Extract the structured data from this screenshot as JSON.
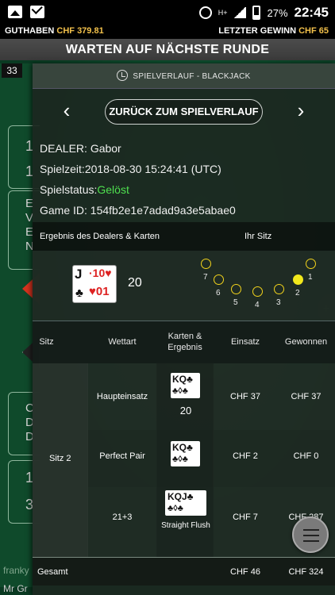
{
  "status_bar": {
    "battery": "27%",
    "time": "22:45",
    "network": "H+"
  },
  "balance_bar": {
    "balance_label": "GUTHABEN",
    "balance_value": "CHF 379.81",
    "last_win_label": "LETZTER GEWINN",
    "last_win_value": "CHF 65"
  },
  "round_status": "WARTEN AUF NÄCHSTE RUNDE",
  "background": {
    "number_badge": "33",
    "player_fragment": "franky",
    "player_fragment2": "Mr Gr",
    "chars": [
      "1",
      "1",
      "E",
      "V",
      "E",
      "N",
      "C",
      "D",
      "D",
      "1",
      "3"
    ]
  },
  "history_panel": {
    "title": "SPIELVERLAUF - BLACKJACK",
    "back_button": "ZURÜCK ZUM SPIELVERLAUF",
    "prev_arrow": "‹",
    "next_arrow": "›",
    "dealer_label": "DEALER: ",
    "dealer_name": "Gabor",
    "time_label": "Spielzeit:",
    "time_value": "2018-08-30 15:24:41 (UTC)",
    "status_label": "Spielstatus:",
    "status_value": "Gelöst",
    "game_id_label": "Game ID: ",
    "game_id_value": "154fb2e1e7adad9a3e5abae0",
    "results_header_left": "Ergebnis des Dealers & Karten",
    "results_header_right": "Ihr Sitz",
    "dealer_cards": [
      "J♣",
      "10♥"
    ],
    "dealer_score": "20",
    "seats": [
      "1",
      "2",
      "3",
      "4",
      "5",
      "6",
      "7"
    ],
    "your_seat": "2",
    "table_headers": {
      "seat": "Sitz",
      "bet_type": "Wettart",
      "cards_result": "Karten & Ergebnis",
      "stake": "Einsatz",
      "won": "Gewonnen"
    },
    "seat_name": "Sitz 2",
    "rows": [
      {
        "bet_type": "Haupteinsatz",
        "cards": [
          "K♣",
          "Q♣"
        ],
        "result": "20",
        "stake": "CHF 37",
        "won": "CHF 37"
      },
      {
        "bet_type": "Perfect Pair",
        "cards": [
          "K♣",
          "Q♣"
        ],
        "result": "",
        "stake": "CHF 2",
        "won": "CHF 0"
      },
      {
        "bet_type": "21+3",
        "cards": [
          "K♣",
          "Q♣",
          "J♣"
        ],
        "result": "Straight Flush",
        "stake": "CHF 7",
        "won": "CHF 287"
      }
    ],
    "total_label": "Gesamt",
    "total_stake": "CHF 46",
    "total_won": "CHF 324"
  },
  "colors": {
    "accent_gold": "#f3c14b",
    "status_green": "#4fe04f",
    "seat_yellow": "#f2e81c"
  }
}
